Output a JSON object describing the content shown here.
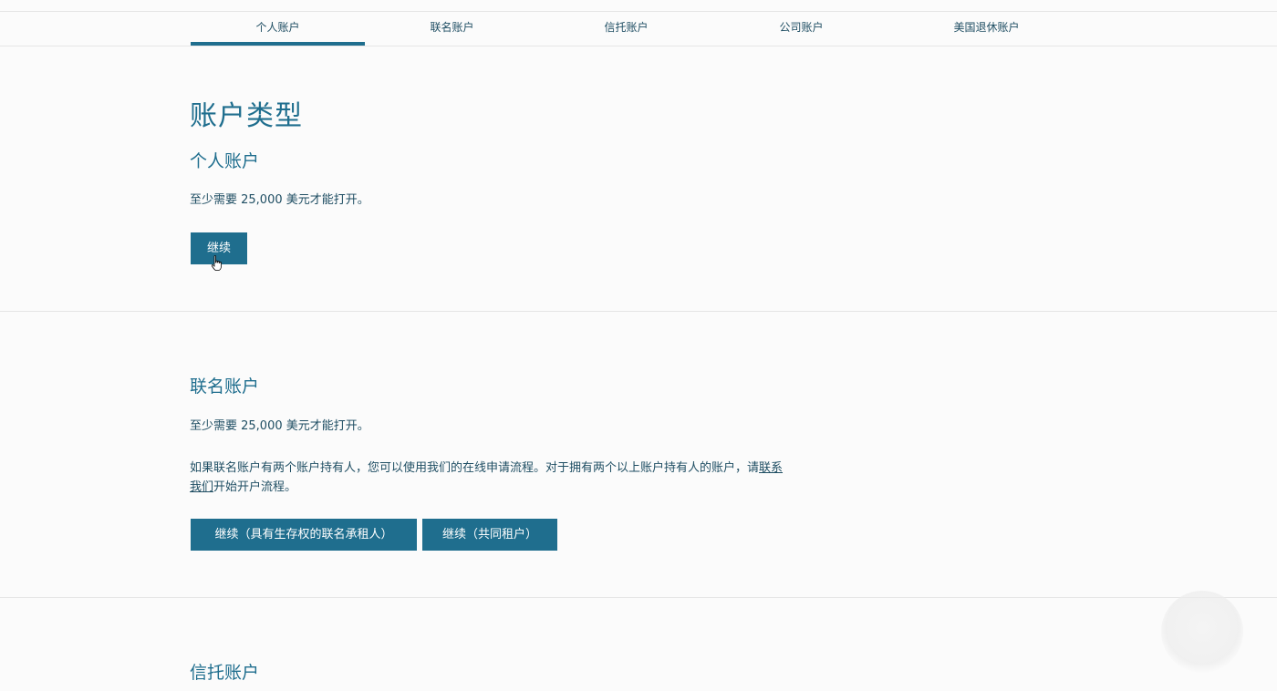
{
  "tabs": [
    {
      "label": "个人账户",
      "active": true
    },
    {
      "label": "联名账户",
      "active": false
    },
    {
      "label": "信托账户",
      "active": false
    },
    {
      "label": "公司账户",
      "active": false
    },
    {
      "label": "美国退休账户",
      "active": false
    }
  ],
  "page": {
    "title": "账户类型"
  },
  "individual": {
    "heading": "个人账户",
    "min_text": "至少需要 25,000 美元才能打开。",
    "continue_label": "继续"
  },
  "joint": {
    "heading": "联名账户",
    "min_text": "至少需要 25,000 美元才能打开。",
    "info_text": "如果联名账户有两个账户持有人，您可以使用我们的在线申请流程。对于拥有两个以上账户持有人的账户，请",
    "contact_link": "联系我们",
    "info_tail": "开始开户流程。",
    "button_survivorship": "继续（具有生存权的联名承租人）",
    "button_common": "继续（共同租户）"
  },
  "trust": {
    "heading": "信托账户"
  },
  "colors": {
    "accent": "#1f6e8e",
    "text": "#1f4e63",
    "background": "#fbfbfb"
  }
}
